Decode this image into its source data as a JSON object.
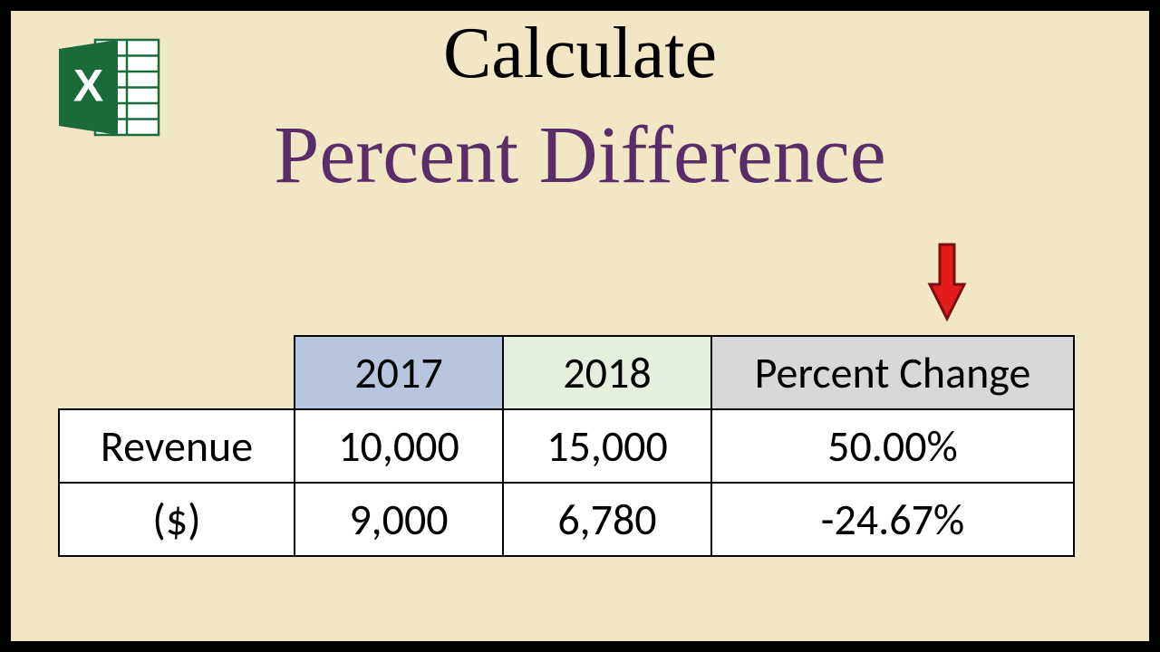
{
  "title_line1": "Calculate",
  "title_line2": "Percent Difference",
  "icon_name": "excel-icon",
  "arrow_name": "arrow-down-icon",
  "table": {
    "col_headers": [
      "2017",
      "2018",
      "Percent Change"
    ],
    "row_label_top": "Revenue",
    "row_label_bottom": "($)",
    "rows": [
      {
        "y2017": "10,000",
        "y2018": "15,000",
        "pct": "50.00%"
      },
      {
        "y2017": "9,000",
        "y2018": "6,780",
        "pct": "-24.67%"
      }
    ]
  },
  "chart_data": {
    "type": "table",
    "title": "Calculate Percent Difference",
    "columns": [
      "2017",
      "2018",
      "Percent Change"
    ],
    "row_label": "Revenue ($)",
    "rows": [
      {
        "2017": 10000,
        "2018": 15000,
        "percent_change": 50.0
      },
      {
        "2017": 9000,
        "2018": 6780,
        "percent_change": -24.67
      }
    ]
  }
}
